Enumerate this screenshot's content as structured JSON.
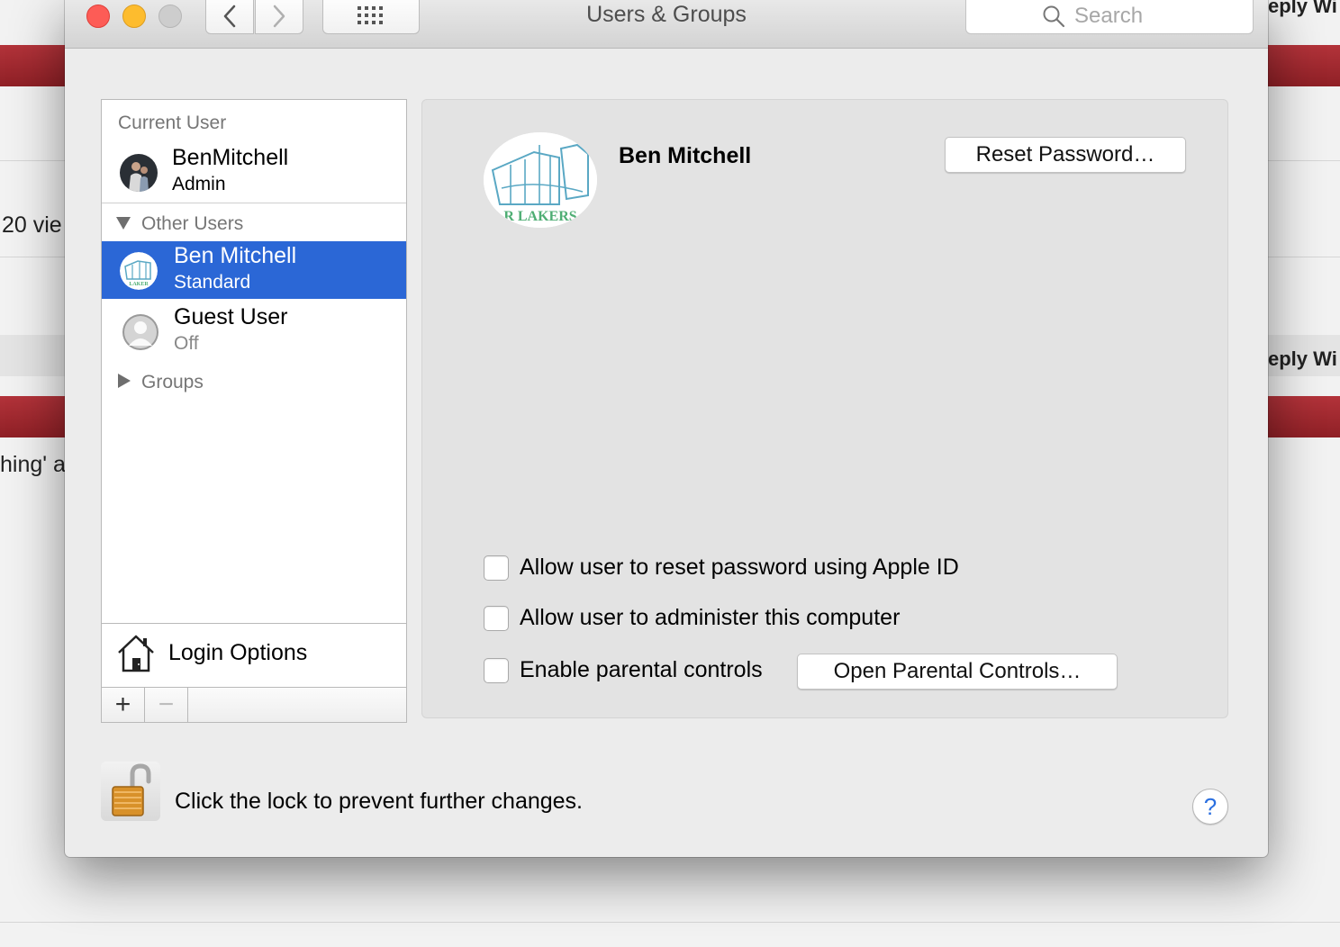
{
  "background": {
    "snippet_top_right": "eply Wi",
    "snippet_views": "20 vie",
    "snippet_mid_right": "eply Wi",
    "snippet_left": "hing' a"
  },
  "window": {
    "title": "Users & Groups",
    "search_placeholder": "Search"
  },
  "sidebar": {
    "current_user_heading": "Current User",
    "current_user": {
      "name": "BenMitchell",
      "role": "Admin"
    },
    "other_users_heading": "Other Users",
    "other_users": [
      {
        "name": "Ben Mitchell",
        "role": "Standard",
        "selected": true
      },
      {
        "name": "Guest User",
        "role": "Off",
        "selected": false
      }
    ],
    "groups_heading": "Groups",
    "login_options_label": "Login Options",
    "add_label": "+",
    "remove_label": "−"
  },
  "detail": {
    "full_name": "Ben Mitchell",
    "picture_text": "R LAKERS",
    "reset_password_button": "Reset Password…",
    "options": [
      {
        "label": "Allow user to reset password using Apple ID",
        "checked": false
      },
      {
        "label": "Allow user to administer this computer",
        "checked": false
      },
      {
        "label": "Enable parental controls",
        "checked": false
      }
    ],
    "open_parental_controls_button": "Open Parental Controls…"
  },
  "footer": {
    "lock_message": "Click the lock to prevent further changes.",
    "help_label": "?"
  },
  "colors": {
    "selection": "#2b67d6",
    "header_red": "#a52a31",
    "help_blue": "#2a6fe0"
  }
}
